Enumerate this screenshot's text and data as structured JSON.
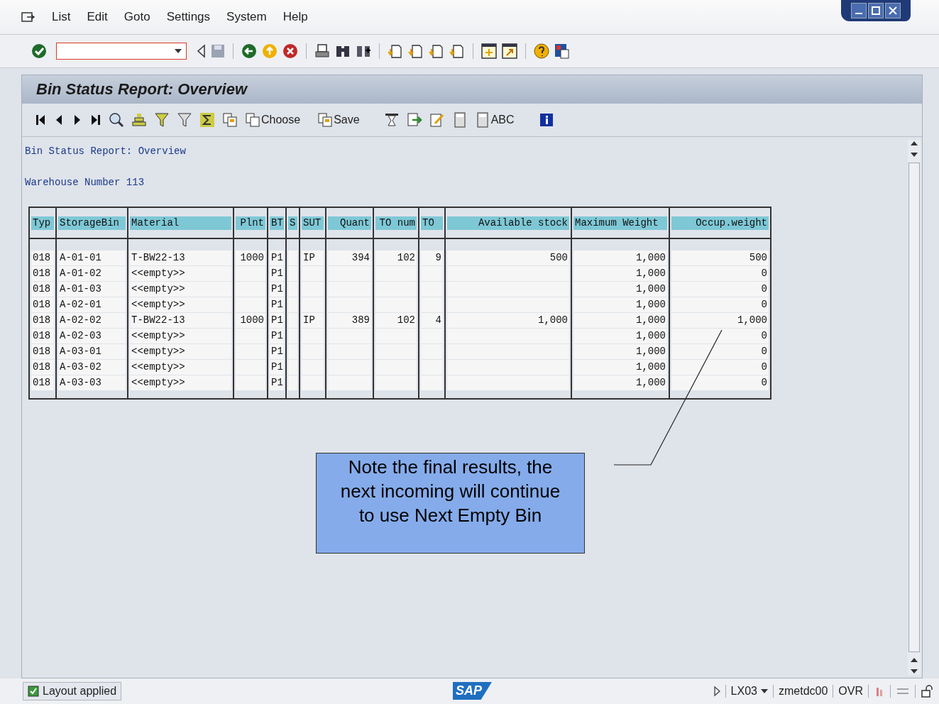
{
  "menu": [
    {
      "label": "List"
    },
    {
      "label": "Edit"
    },
    {
      "label": "Goto"
    },
    {
      "label": "Settings"
    },
    {
      "label": "System"
    },
    {
      "label": "Help"
    }
  ],
  "screen": {
    "title": "Bin Status Report: Overview"
  },
  "app_toolbar": [
    {
      "label": "Choose"
    },
    {
      "label": "Save"
    },
    {
      "label": "ABC"
    }
  ],
  "report": {
    "heading": "Bin Status Report: Overview",
    "warehouse": "Warehouse Number 113"
  },
  "table": {
    "columns": [
      {
        "label": "Typ"
      },
      {
        "label": "StorageBin"
      },
      {
        "label": "Material"
      },
      {
        "label": "Plnt"
      },
      {
        "label": "BT"
      },
      {
        "label": "S"
      },
      {
        "label": "SUT"
      },
      {
        "label": "Quant"
      },
      {
        "label": "TO num"
      },
      {
        "label": "TO"
      },
      {
        "label": "Available stock"
      },
      {
        "label": "Maximum Weight"
      },
      {
        "label": "Occup.weight"
      }
    ],
    "rows": [
      [
        "018",
        "A-01-01",
        "T-BW22-13",
        "1000",
        "P1",
        "",
        "IP",
        "394",
        "102",
        "9",
        "500",
        "1,000",
        "500"
      ],
      [
        "018",
        "A-01-02",
        "<<empty>>",
        "",
        "P1",
        "",
        "",
        "",
        "",
        "",
        "",
        "1,000",
        "0"
      ],
      [
        "018",
        "A-01-03",
        "<<empty>>",
        "",
        "P1",
        "",
        "",
        "",
        "",
        "",
        "",
        "1,000",
        "0"
      ],
      [
        "018",
        "A-02-01",
        "<<empty>>",
        "",
        "P1",
        "",
        "",
        "",
        "",
        "",
        "",
        "1,000",
        "0"
      ],
      [
        "018",
        "A-02-02",
        "T-BW22-13",
        "1000",
        "P1",
        "",
        "IP",
        "389",
        "102",
        "4",
        "1,000",
        "1,000",
        "1,000"
      ],
      [
        "018",
        "A-02-03",
        "<<empty>>",
        "",
        "P1",
        "",
        "",
        "",
        "",
        "",
        "",
        "1,000",
        "0"
      ],
      [
        "018",
        "A-03-01",
        "<<empty>>",
        "",
        "P1",
        "",
        "",
        "",
        "",
        "",
        "",
        "1,000",
        "0"
      ],
      [
        "018",
        "A-03-02",
        "<<empty>>",
        "",
        "P1",
        "",
        "",
        "",
        "",
        "",
        "",
        "1,000",
        "0"
      ],
      [
        "018",
        "A-03-03",
        "<<empty>>",
        "",
        "P1",
        "",
        "",
        "",
        "",
        "",
        "",
        "1,000",
        "0"
      ]
    ]
  },
  "callout": {
    "text": "Note the final results, the next incoming will continue to use Next Empty Bin"
  },
  "status_bar": {
    "message": "Layout applied",
    "logo": "SAP",
    "transaction": "LX03",
    "server": "zmetdc00",
    "mode": "OVR"
  }
}
